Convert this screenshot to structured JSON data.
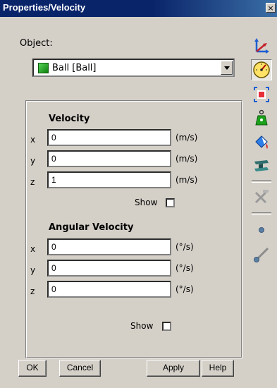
{
  "window": {
    "title": "Properties/Velocity",
    "close_glyph": "×"
  },
  "object": {
    "label": "Object:",
    "selected": "Ball  [Ball]",
    "icon": "green-cube-icon",
    "color": "#1aa11a"
  },
  "velocity": {
    "heading": "Velocity",
    "rows": [
      {
        "axis": "x",
        "value": "0",
        "unit": "(m/s)"
      },
      {
        "axis": "y",
        "value": "0",
        "unit": "(m/s)"
      },
      {
        "axis": "z",
        "value": "1",
        "unit": "(m/s)"
      }
    ],
    "show_label": "Show"
  },
  "angular": {
    "heading": "Angular Velocity",
    "rows": [
      {
        "axis": "x",
        "value": "0",
        "unit": "(°/s)"
      },
      {
        "axis": "y",
        "value": "0",
        "unit": "(°/s)"
      },
      {
        "axis": "z",
        "value": "0",
        "unit": "(°/s)"
      }
    ],
    "show_label": "Show"
  },
  "buttons": {
    "ok": "OK",
    "cancel": "Cancel",
    "apply": "Apply",
    "help": "Help"
  },
  "toolbar": [
    {
      "icon": "axes-icon",
      "active": false
    },
    {
      "icon": "speedometer-icon",
      "active": true
    },
    {
      "icon": "bounding-box-icon",
      "active": false
    },
    {
      "icon": "mass-weight-icon",
      "active": false
    },
    {
      "icon": "paint-bucket-icon",
      "active": false
    },
    {
      "icon": "beam-icon",
      "active": false
    },
    {
      "icon": "tools-icon",
      "active": false
    },
    {
      "icon": "point-icon",
      "active": false
    },
    {
      "icon": "spring-link-icon",
      "active": false
    }
  ]
}
